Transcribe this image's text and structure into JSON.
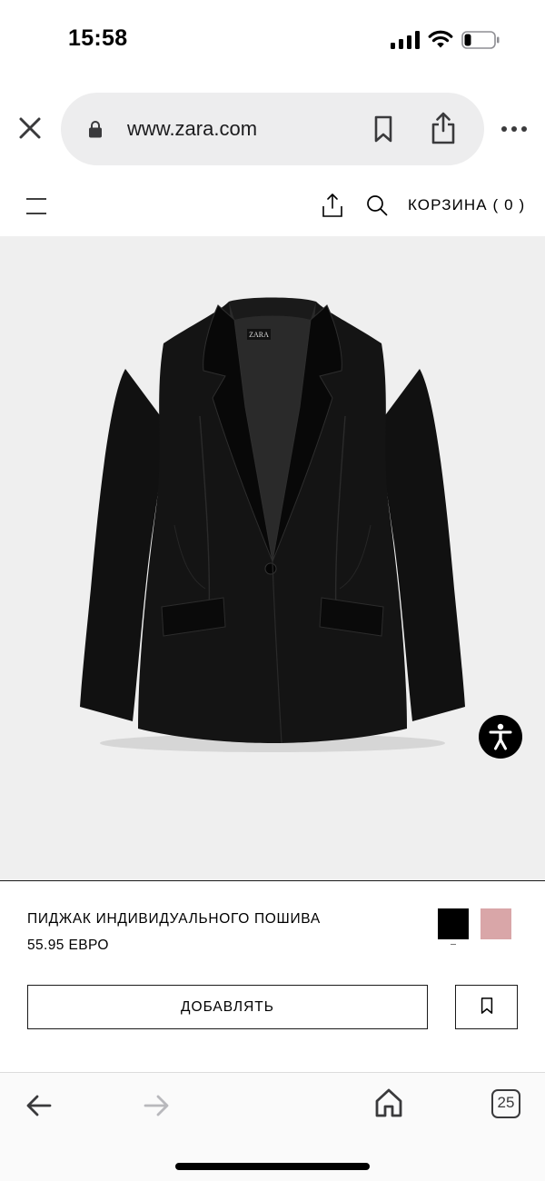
{
  "status_bar": {
    "time": "15:58"
  },
  "browser": {
    "url": "www.zara.com",
    "icons": {
      "close": "close-icon",
      "lock": "lock-icon",
      "bookmark": "bookmark-icon",
      "share": "share-icon",
      "more": "more-icon"
    }
  },
  "site_header": {
    "cart_label": "КОРЗИНА ( 0 )",
    "icons": {
      "menu": "hamburger-menu-icon",
      "share": "share-icon",
      "search": "search-icon"
    }
  },
  "product": {
    "name": "ПИДЖАК ИНДИВИДУАЛЬНОГО ПОШИВА",
    "price": "55.95 ЕВРО",
    "image_label": "ZARA",
    "colors": [
      {
        "name": "black",
        "hex": "#000000",
        "selected": true
      },
      {
        "name": "pink",
        "hex": "#d9a6a8",
        "selected": false
      }
    ],
    "add_button_label": "ДОБАВЛЯТЬ"
  },
  "toolbar": {
    "tab_count": "25",
    "icons": {
      "back": "back-arrow-icon",
      "forward": "forward-arrow-icon",
      "home": "home-icon",
      "tabs": "tabs-icon"
    }
  },
  "colors": {
    "image_background": "#efefef",
    "url_pill": "#ededee",
    "accessibility_button": "#000000"
  }
}
